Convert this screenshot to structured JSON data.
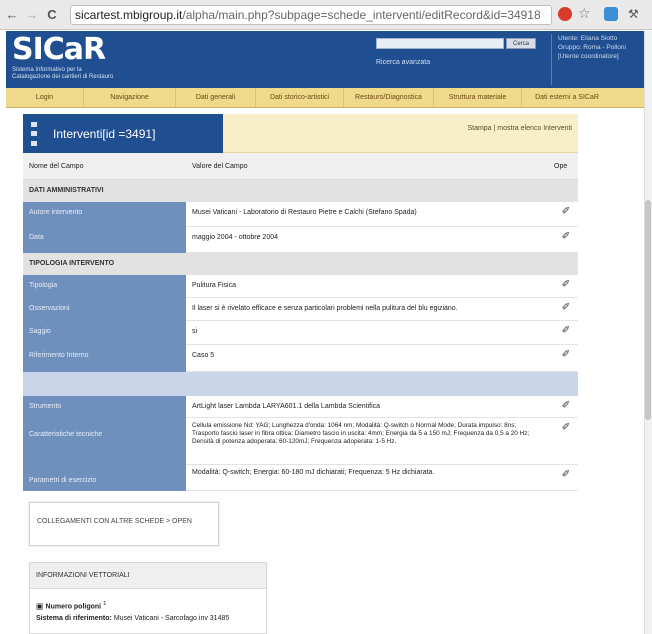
{
  "browser": {
    "back_icon": "←",
    "forward_icon": "→",
    "reload_icon": "C",
    "url_host": "sicartest.mbigroup.it",
    "url_path": "/alpha/main.php?subpage=schede_interventi/editRecord&id=34918"
  },
  "header": {
    "logo": "SICaR",
    "logo_sub_1": "Sistema Informativo per la",
    "logo_sub_2": "Catalogazione dei cantieri di Restauro",
    "search_button": "Cerca",
    "advanced_search": "Ricerca avanzata",
    "user_line1": "Utente: Eliana Siotto",
    "user_line2": "Gruppo: Roma - Polloni",
    "user_line3": "[Utente coordinatore]"
  },
  "menu": [
    "Login",
    "Navigazione",
    "Dati generali",
    "Dati storico-artistici",
    "Restauro/Diagnostica",
    "Struttura materiale",
    "Dati esterni a SICaR"
  ],
  "page": {
    "title": "Interventi[id =3491]",
    "actions": "Stampa | mostra elenco Interventi"
  },
  "table": {
    "col_name": "Nome del Campo",
    "col_value": "Valore del Campo",
    "col_op": "Ope"
  },
  "sections": {
    "admin": "DATI AMMINISTRATIVI",
    "tipologia": "TIPOLOGIA INTERVENTO"
  },
  "rows": {
    "autore_label": "Autore intervento",
    "autore_value": "Musei Vaticani - Laboratorio di Restauro Pietre e Calchi (Stefano Spada)",
    "data_label": "Data",
    "data_value": "maggio 2004 - ottobre 2004",
    "tipologia_label": "Tipologia",
    "tipologia_value": "Pulitura Fisica",
    "osservazioni_label": "Osservazioni",
    "osservazioni_value": "Il laser si è rivelato efficace e senza particolari problemi nella pulitura del blu egiziano.",
    "saggio_label": "Saggio",
    "saggio_value": "si",
    "riferimento_label": "Riferimento Interno",
    "riferimento_value": "Caso 5",
    "strumento_label": "Strumento",
    "strumento_value": "ArtLight laser Lambda LARYA601.1 della Lambda Scientifica",
    "caratteristiche_label": "Caratteristiche tecniche",
    "caratteristiche_value": "Cellula emissione Nd: YAG; Lunghezza d'onda: 1064 nm; Modalità: Q-switch o Normal Mode; Durata impulso: 8ns; Trasporto fascio laser in fibra ottica; Diametro fascio in uscita: 4mm; Energia da 5 a 150 mJ; Frequenza da 0,5 a 20 Hz; Densità di potenza adoperata: 60-120mJ; Frequenza adoperata: 1-5 Hz.",
    "parametri_label": "Parametri di esercizio",
    "parametri_value": "Modalità: Q-switch; Energia: 60-180 mJ dichiarati; Frequenza: 5 Hz dichiarata.",
    "edit_icon": "✐"
  },
  "boxes": {
    "collegamenti": "COLLEGAMENTI CON ALTRE SCHEDE > OPEN",
    "info_head": "INFORMAZIONI VETTORIALI",
    "numero_label": "Numero poligoni",
    "numero_value": "1",
    "sistema_label": "Sistema di riferimento:",
    "sistema_value": "Musei Vaticani - Sarcofago inv 31485"
  }
}
